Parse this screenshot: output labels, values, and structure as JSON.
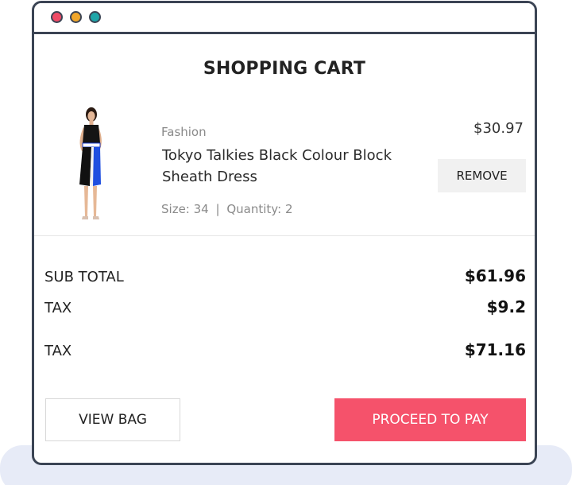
{
  "window": {
    "controls": [
      "close",
      "minimize",
      "maximize"
    ]
  },
  "cart": {
    "title": "SHOPPING CART"
  },
  "product": {
    "category": "Fashion",
    "name": "Tokyo Talkies Black Colour Block Sheath Dress",
    "size_label": "Size:",
    "size_value": "34",
    "separator": "|",
    "quantity_label": "Quantity:",
    "quantity_value": "2",
    "price": "$30.97",
    "remove_label": "REMOVE",
    "image_icon": "dress-model-image"
  },
  "summary": {
    "subtotal_label": "SUB TOTAL",
    "subtotal_value": "$61.96",
    "tax_label": "TAX",
    "tax_value": "$9.2",
    "total_label": "TAX",
    "total_value": "$71.16"
  },
  "actions": {
    "view_bag_label": "VIEW BAG",
    "pay_label": "PROCEED TO PAY"
  },
  "colors": {
    "accent": "#f5526b",
    "window_border": "#3b4454",
    "dot_red": "#ef4b66",
    "dot_yellow": "#f0a62a",
    "dot_teal": "#1ea5a8",
    "background_shadow": "#e7ebf7"
  }
}
